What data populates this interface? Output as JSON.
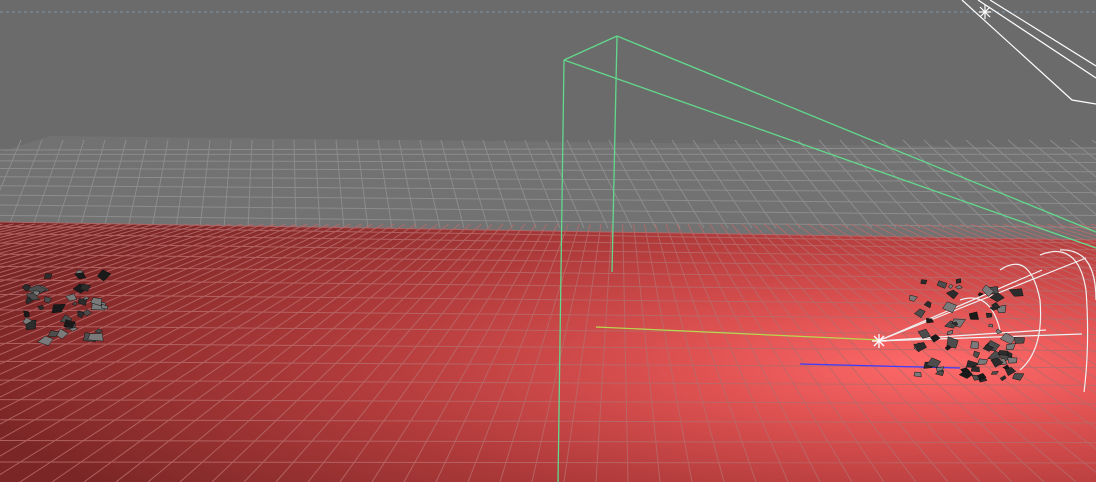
{
  "viewport": {
    "background_color": "#6b6b6b",
    "ground_lit_color": "#d54a4a",
    "ground_dark_color": "#7e2a2a",
    "grid_color_far": "#8a8a8a",
    "grid_color_near": "#a75a5a",
    "boundary_box_color": "#62d98c",
    "emitter_cone_color": "#f2f2f2",
    "axis_x_color": "#b8d94f",
    "axis_z_color": "#3c3cff",
    "debris_colors": [
      "#2c2c2c",
      "#1a1a1a",
      "#4d4d4d",
      "#7a7a7a"
    ]
  },
  "scene": {
    "objects": [
      {
        "name": "rigid-body-debris-left",
        "icon": "debris-cluster"
      },
      {
        "name": "rigid-body-debris-right",
        "icon": "debris-cluster"
      },
      {
        "name": "emitter-cone",
        "icon": "cone-wireframe"
      },
      {
        "name": "bounding-volume",
        "icon": "wireframe-box"
      },
      {
        "name": "light-locator",
        "icon": "light-star"
      }
    ]
  }
}
